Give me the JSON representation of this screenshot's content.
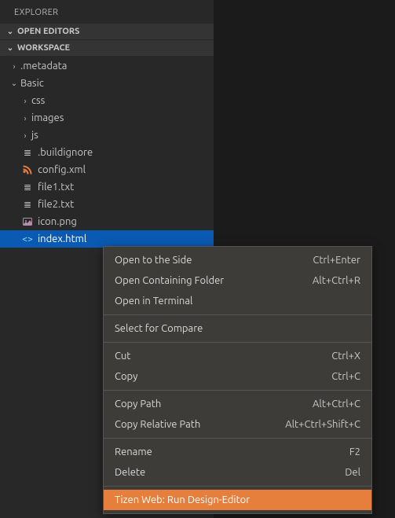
{
  "sidebar": {
    "title": "EXPLORER",
    "sections": [
      {
        "label": "OPEN EDITORS",
        "expanded": true
      },
      {
        "label": "WORKSPACE",
        "expanded": true
      }
    ],
    "tree": [
      {
        "type": "folder",
        "label": ".metadata",
        "expanded": false,
        "depth": 1,
        "icon": "chevron"
      },
      {
        "type": "folder",
        "label": "Basic",
        "expanded": true,
        "depth": 1,
        "icon": "chevron"
      },
      {
        "type": "folder",
        "label": "css",
        "expanded": false,
        "depth": 2,
        "icon": "chevron"
      },
      {
        "type": "folder",
        "label": "images",
        "expanded": false,
        "depth": 2,
        "icon": "chevron"
      },
      {
        "type": "folder",
        "label": "js",
        "expanded": false,
        "depth": 2,
        "icon": "chevron"
      },
      {
        "type": "file",
        "label": ".buildignore",
        "depth": 2,
        "icon": "text"
      },
      {
        "type": "file",
        "label": "config.xml",
        "depth": 2,
        "icon": "rss"
      },
      {
        "type": "file",
        "label": "file1.txt",
        "depth": 2,
        "icon": "text"
      },
      {
        "type": "file",
        "label": "file2.txt",
        "depth": 2,
        "icon": "text"
      },
      {
        "type": "file",
        "label": "icon.png",
        "depth": 2,
        "icon": "image"
      },
      {
        "type": "file",
        "label": "index.html",
        "depth": 2,
        "icon": "code",
        "selected": true
      }
    ]
  },
  "context_menu": {
    "groups": [
      [
        {
          "label": "Open to the Side",
          "shortcut": "Ctrl+Enter"
        },
        {
          "label": "Open Containing Folder",
          "shortcut": "Alt+Ctrl+R"
        },
        {
          "label": "Open in Terminal",
          "shortcut": ""
        }
      ],
      [
        {
          "label": "Select for Compare",
          "shortcut": ""
        }
      ],
      [
        {
          "label": "Cut",
          "shortcut": "Ctrl+X"
        },
        {
          "label": "Copy",
          "shortcut": "Ctrl+C"
        }
      ],
      [
        {
          "label": "Copy Path",
          "shortcut": "Alt+Ctrl+C"
        },
        {
          "label": "Copy Relative Path",
          "shortcut": "Alt+Ctrl+Shift+C"
        }
      ],
      [
        {
          "label": "Rename",
          "shortcut": "F2"
        },
        {
          "label": "Delete",
          "shortcut": "Del"
        }
      ],
      [
        {
          "label": "Tizen Web: Run Design-Editor",
          "shortcut": "",
          "highlight": true
        }
      ]
    ]
  },
  "icons": {
    "chevron_right": "›",
    "chevron_down": "⌄"
  }
}
